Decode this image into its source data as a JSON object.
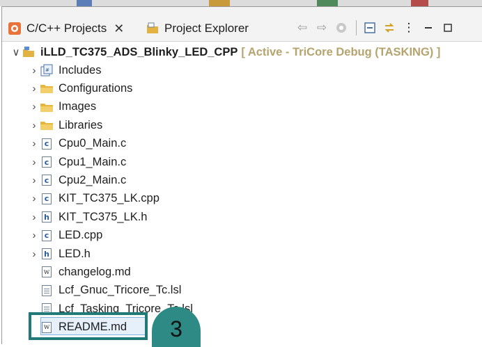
{
  "tabs": [
    {
      "label": "C/C++ Projects",
      "active": true,
      "close": "✕",
      "icon": "cpp-projects-icon"
    },
    {
      "label": "Project Explorer",
      "active": false,
      "icon": "project-explorer-icon"
    }
  ],
  "toolbar": {
    "back": "⇦",
    "forward": "⇨",
    "menu": "⋮",
    "minimize": "▬",
    "maximize": "☐"
  },
  "tree": {
    "root": {
      "label": "iLLD_TC375_ADS_Blinky_LED_CPP",
      "info": "[ Active - TriCore Debug (TASKING) ]",
      "chevron": "∨"
    },
    "items": [
      {
        "label": "Includes",
        "icon": "includes",
        "expandable": true
      },
      {
        "label": "Configurations",
        "icon": "folder",
        "expandable": true
      },
      {
        "label": "Images",
        "icon": "folder",
        "expandable": true
      },
      {
        "label": "Libraries",
        "icon": "folder",
        "expandable": true
      },
      {
        "label": "Cpu0_Main.c",
        "icon": "c",
        "expandable": true
      },
      {
        "label": "Cpu1_Main.c",
        "icon": "c",
        "expandable": true
      },
      {
        "label": "Cpu2_Main.c",
        "icon": "c",
        "expandable": true
      },
      {
        "label": "KIT_TC375_LK.cpp",
        "icon": "c",
        "expandable": true
      },
      {
        "label": "KIT_TC375_LK.h",
        "icon": "h",
        "expandable": true
      },
      {
        "label": "LED.cpp",
        "icon": "c",
        "expandable": true
      },
      {
        "label": "LED.h",
        "icon": "h",
        "expandable": true
      },
      {
        "label": "changelog.md",
        "icon": "w",
        "expandable": false
      },
      {
        "label": "Lcf_Gnuc_Tricore_Tc.lsl",
        "icon": "txt",
        "expandable": false
      },
      {
        "label": "Lcf_Tasking_Tricore_Tc.lsl",
        "icon": "txt",
        "expandable": false
      },
      {
        "label": "README.md",
        "icon": "w",
        "expandable": false,
        "selected": true
      }
    ],
    "chevron_collapsed": "›"
  },
  "callout": {
    "number": "3"
  },
  "colors": {
    "accent_teal": "#2d8a85",
    "selection_border": "#7fb3e6",
    "active_info": "#b5a46e"
  }
}
